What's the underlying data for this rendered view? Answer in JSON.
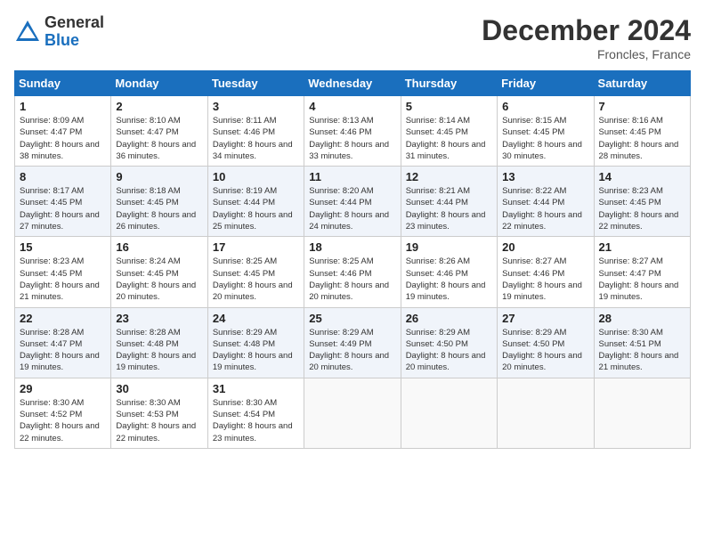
{
  "header": {
    "logo": {
      "line1": "General",
      "line2": "Blue"
    },
    "month": "December 2024",
    "location": "Froncles, France"
  },
  "weekdays": [
    "Sunday",
    "Monday",
    "Tuesday",
    "Wednesday",
    "Thursday",
    "Friday",
    "Saturday"
  ],
  "weeks": [
    [
      {
        "day": "1",
        "sunrise": "8:09 AM",
        "sunset": "4:47 PM",
        "daylight": "8 hours and 38 minutes."
      },
      {
        "day": "2",
        "sunrise": "8:10 AM",
        "sunset": "4:47 PM",
        "daylight": "8 hours and 36 minutes."
      },
      {
        "day": "3",
        "sunrise": "8:11 AM",
        "sunset": "4:46 PM",
        "daylight": "8 hours and 34 minutes."
      },
      {
        "day": "4",
        "sunrise": "8:13 AM",
        "sunset": "4:46 PM",
        "daylight": "8 hours and 33 minutes."
      },
      {
        "day": "5",
        "sunrise": "8:14 AM",
        "sunset": "4:45 PM",
        "daylight": "8 hours and 31 minutes."
      },
      {
        "day": "6",
        "sunrise": "8:15 AM",
        "sunset": "4:45 PM",
        "daylight": "8 hours and 30 minutes."
      },
      {
        "day": "7",
        "sunrise": "8:16 AM",
        "sunset": "4:45 PM",
        "daylight": "8 hours and 28 minutes."
      }
    ],
    [
      {
        "day": "8",
        "sunrise": "8:17 AM",
        "sunset": "4:45 PM",
        "daylight": "8 hours and 27 minutes."
      },
      {
        "day": "9",
        "sunrise": "8:18 AM",
        "sunset": "4:45 PM",
        "daylight": "8 hours and 26 minutes."
      },
      {
        "day": "10",
        "sunrise": "8:19 AM",
        "sunset": "4:44 PM",
        "daylight": "8 hours and 25 minutes."
      },
      {
        "day": "11",
        "sunrise": "8:20 AM",
        "sunset": "4:44 PM",
        "daylight": "8 hours and 24 minutes."
      },
      {
        "day": "12",
        "sunrise": "8:21 AM",
        "sunset": "4:44 PM",
        "daylight": "8 hours and 23 minutes."
      },
      {
        "day": "13",
        "sunrise": "8:22 AM",
        "sunset": "4:44 PM",
        "daylight": "8 hours and 22 minutes."
      },
      {
        "day": "14",
        "sunrise": "8:23 AM",
        "sunset": "4:45 PM",
        "daylight": "8 hours and 22 minutes."
      }
    ],
    [
      {
        "day": "15",
        "sunrise": "8:23 AM",
        "sunset": "4:45 PM",
        "daylight": "8 hours and 21 minutes."
      },
      {
        "day": "16",
        "sunrise": "8:24 AM",
        "sunset": "4:45 PM",
        "daylight": "8 hours and 20 minutes."
      },
      {
        "day": "17",
        "sunrise": "8:25 AM",
        "sunset": "4:45 PM",
        "daylight": "8 hours and 20 minutes."
      },
      {
        "day": "18",
        "sunrise": "8:25 AM",
        "sunset": "4:46 PM",
        "daylight": "8 hours and 20 minutes."
      },
      {
        "day": "19",
        "sunrise": "8:26 AM",
        "sunset": "4:46 PM",
        "daylight": "8 hours and 19 minutes."
      },
      {
        "day": "20",
        "sunrise": "8:27 AM",
        "sunset": "4:46 PM",
        "daylight": "8 hours and 19 minutes."
      },
      {
        "day": "21",
        "sunrise": "8:27 AM",
        "sunset": "4:47 PM",
        "daylight": "8 hours and 19 minutes."
      }
    ],
    [
      {
        "day": "22",
        "sunrise": "8:28 AM",
        "sunset": "4:47 PM",
        "daylight": "8 hours and 19 minutes."
      },
      {
        "day": "23",
        "sunrise": "8:28 AM",
        "sunset": "4:48 PM",
        "daylight": "8 hours and 19 minutes."
      },
      {
        "day": "24",
        "sunrise": "8:29 AM",
        "sunset": "4:48 PM",
        "daylight": "8 hours and 19 minutes."
      },
      {
        "day": "25",
        "sunrise": "8:29 AM",
        "sunset": "4:49 PM",
        "daylight": "8 hours and 20 minutes."
      },
      {
        "day": "26",
        "sunrise": "8:29 AM",
        "sunset": "4:50 PM",
        "daylight": "8 hours and 20 minutes."
      },
      {
        "day": "27",
        "sunrise": "8:29 AM",
        "sunset": "4:50 PM",
        "daylight": "8 hours and 20 minutes."
      },
      {
        "day": "28",
        "sunrise": "8:30 AM",
        "sunset": "4:51 PM",
        "daylight": "8 hours and 21 minutes."
      }
    ],
    [
      {
        "day": "29",
        "sunrise": "8:30 AM",
        "sunset": "4:52 PM",
        "daylight": "8 hours and 22 minutes."
      },
      {
        "day": "30",
        "sunrise": "8:30 AM",
        "sunset": "4:53 PM",
        "daylight": "8 hours and 22 minutes."
      },
      {
        "day": "31",
        "sunrise": "8:30 AM",
        "sunset": "4:54 PM",
        "daylight": "8 hours and 23 minutes."
      },
      null,
      null,
      null,
      null
    ]
  ]
}
